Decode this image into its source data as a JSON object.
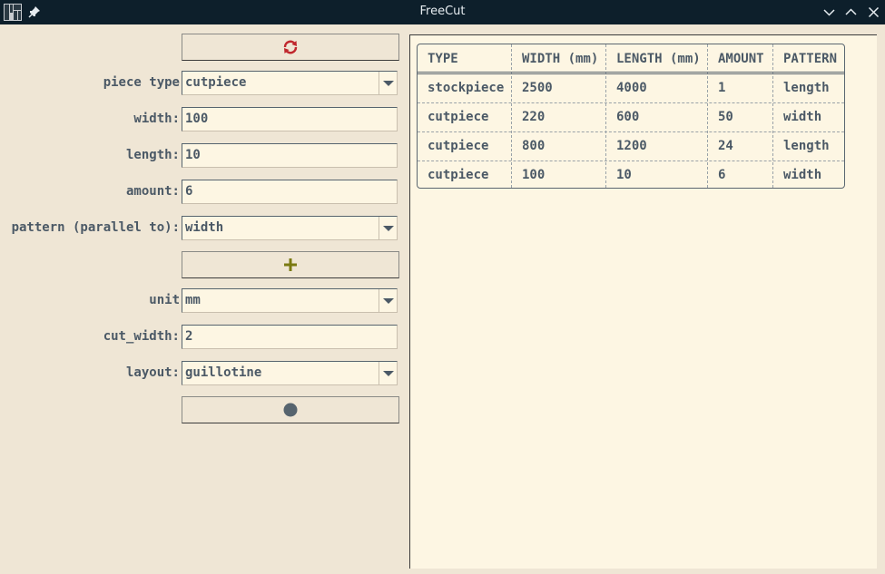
{
  "window": {
    "title": "FreeCut",
    "icons": [
      "app-logo-icon",
      "pin-icon",
      "minimize-icon",
      "maximize-icon",
      "close-icon"
    ]
  },
  "form": {
    "reset_icon": "refresh-icon",
    "piece_type": {
      "label": "piece type",
      "value": "cutpiece"
    },
    "width": {
      "label": "width:",
      "value": "100"
    },
    "length": {
      "label": "length:",
      "value": "10"
    },
    "amount": {
      "label": "amount:",
      "value": "6"
    },
    "pattern": {
      "label": "pattern (parallel to):",
      "value": "width"
    },
    "add_icon": "plus-icon",
    "unit": {
      "label": "unit",
      "value": "mm"
    },
    "cut_width": {
      "label": "cut_width:",
      "value": "2"
    },
    "layout": {
      "label": "layout:",
      "value": "guillotine"
    },
    "run_icon": "circle-icon"
  },
  "table": {
    "headers": [
      "TYPE",
      "WIDTH (mm)",
      "LENGTH (mm)",
      "AMOUNT",
      "PATTERN"
    ],
    "rows": [
      [
        "stockpiece",
        "2500",
        "4000",
        "1",
        "length"
      ],
      [
        "cutpiece",
        "220",
        "600",
        "50",
        "width"
      ],
      [
        "cutpiece",
        "800",
        "1200",
        "24",
        "length"
      ],
      [
        "cutpiece",
        "100",
        "10",
        "6",
        "width"
      ]
    ]
  },
  "colors": {
    "titlebar": "#0d1f2b",
    "panel_bg": "#efe6d5",
    "field_bg": "#fdf6e3",
    "text": "#4b5966",
    "refresh_red": "#c0272d",
    "plus_olive": "#7a7a12",
    "circle_grey": "#56646e"
  }
}
